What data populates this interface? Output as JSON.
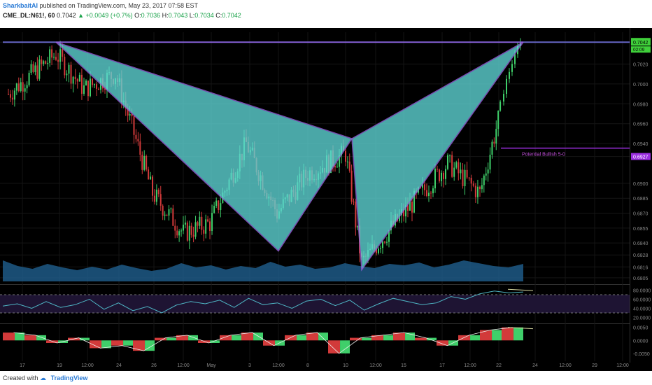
{
  "header": {
    "author": "SharkbaitAI",
    "published_text": "published on TradingView.com, May 23, 2017 07:58 EST",
    "symbol": "CME_DL:N61!, 60",
    "last": "0.7042",
    "change": "+0.0049 (+0.7%)",
    "o_label": "O:",
    "o_value": "0.7036",
    "h_label": "H:",
    "h_value": "0.7043",
    "l_label": "L:",
    "l_value": "0.7034",
    "c_label": "C:",
    "c_value": "0.7042"
  },
  "footer": {
    "created_with": "Created with",
    "brand": "TradingView"
  },
  "colors": {
    "background": "#000000",
    "up_candle": "#3fcf6a",
    "down_candle": "#d23a3a",
    "pattern_fill": "#5fd6d6",
    "pattern_line": "#9b5fe0",
    "rsi_line": "#4fb7c6",
    "volume": "#1f5f8f"
  },
  "chart_data": [
    {
      "type": "line",
      "title": "CME_DL:N61!, 60",
      "price_axis_ticks": [
        "0.7042",
        "0.7020",
        "0.7000",
        "0.6980",
        "0.6960",
        "0.6940",
        "0.6927",
        "0.6900",
        "0.6885",
        "0.6870",
        "0.6855",
        "0.6840",
        "0.6828",
        "0.6816",
        "0.6805"
      ],
      "last_price_label": "0.7042",
      "last_price_sub": "02:09",
      "level_label": "0.6927",
      "x_tick_labels": [
        "17",
        "19",
        "12:00",
        "24",
        "26",
        "12:00",
        "May",
        "3",
        "12:00",
        "8",
        "10",
        "12:00",
        "15",
        "17",
        "12:00",
        "22",
        "24",
        "12:00",
        "29",
        "12:00"
      ],
      "series": [
        {
          "x": [
            "17",
            "19",
            "12:00",
            "24",
            "26",
            "12:00",
            "May",
            "3",
            "12:00",
            "8",
            "10",
            "12:00",
            "15",
            "17",
            "12:00",
            "22"
          ],
          "values": [
            0.699,
            0.703,
            0.6995,
            0.701,
            0.689,
            0.685,
            0.686,
            0.694,
            0.687,
            0.691,
            0.693,
            0.682,
            0.687,
            0.692,
            0.689,
            0.698
          ]
        }
      ],
      "pattern": {
        "points": [
          {
            "x": "19",
            "y": 0.7042
          },
          {
            "x": "3",
            "y": 0.6832
          },
          {
            "x": "10",
            "y": 0.6945
          },
          {
            "x": "12:00",
            "y": 0.6813
          },
          {
            "x": "22",
            "y": 0.7042
          }
        ],
        "label": "Potential Bullish 5-0"
      }
    },
    {
      "type": "line",
      "title": "",
      "y_ticks": [
        "80.0000",
        "60.0000",
        "40.0000",
        "20.0000"
      ],
      "ylim": [
        10,
        90
      ],
      "values": [
        45,
        50,
        40,
        55,
        42,
        48,
        60,
        38,
        52,
        35,
        44,
        30,
        47,
        55,
        50,
        58,
        42,
        62,
        48,
        52,
        40,
        56,
        60,
        46,
        58,
        36,
        50,
        62,
        55,
        48,
        52,
        66,
        60,
        72,
        78,
        74,
        76
      ]
    },
    {
      "type": "bar",
      "title": "",
      "y_ticks": [
        "0.0050",
        "0.0000",
        "-0.0050"
      ],
      "ylim": [
        -0.008,
        0.006
      ],
      "values": [
        0.003,
        0.002,
        -0.001,
        0.001,
        -0.003,
        -0.002,
        -0.004,
        0.001,
        0.002,
        -0.001,
        0.002,
        0.003,
        -0.002,
        0.002,
        0.003,
        -0.005,
        0.001,
        0.002,
        0.003,
        0.001,
        -0.002,
        0.002,
        0.004,
        0.005
      ]
    }
  ]
}
